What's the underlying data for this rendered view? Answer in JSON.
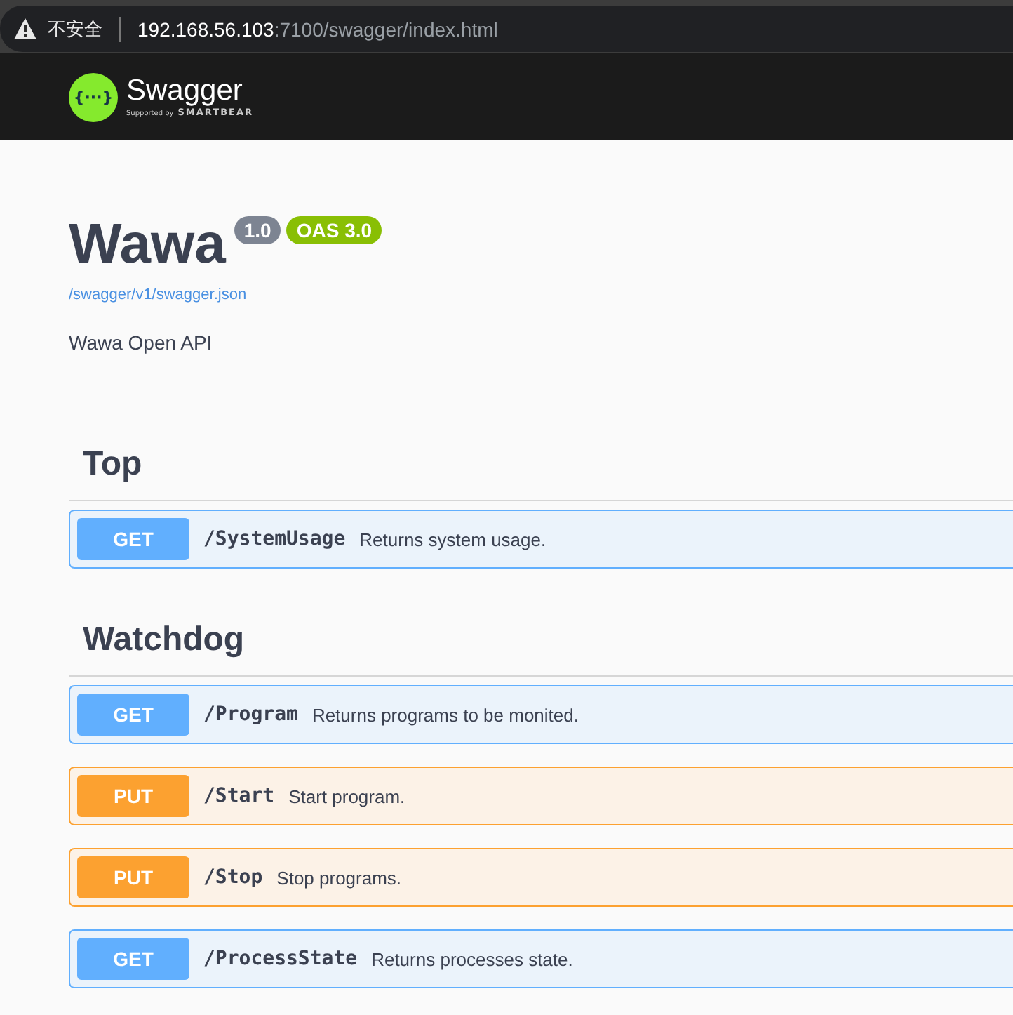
{
  "browser": {
    "security_label": "不安全",
    "url_host": "192.168.56.103",
    "url_rest": ":7100/swagger/index.html"
  },
  "topbar": {
    "logo_glyph": "{···}",
    "logo_name": "Swagger",
    "supported_by": "Supported by",
    "vendor": "SMARTBEAR"
  },
  "info": {
    "title": "Wawa",
    "version": "1.0",
    "oas": "OAS 3.0",
    "spec_link": "/swagger/v1/swagger.json",
    "description": "Wawa Open API"
  },
  "sections": [
    {
      "name": "Top",
      "operations": [
        {
          "method": "GET",
          "path": "/SystemUsage",
          "summary": "Returns system usage."
        }
      ]
    },
    {
      "name": "Watchdog",
      "operations": [
        {
          "method": "GET",
          "path": "/Program",
          "summary": "Returns programs to be monited."
        },
        {
          "method": "PUT",
          "path": "/Start",
          "summary": "Start program."
        },
        {
          "method": "PUT",
          "path": "/Stop",
          "summary": "Stop programs."
        },
        {
          "method": "GET",
          "path": "/ProcessState",
          "summary": "Returns processes state."
        }
      ]
    }
  ]
}
